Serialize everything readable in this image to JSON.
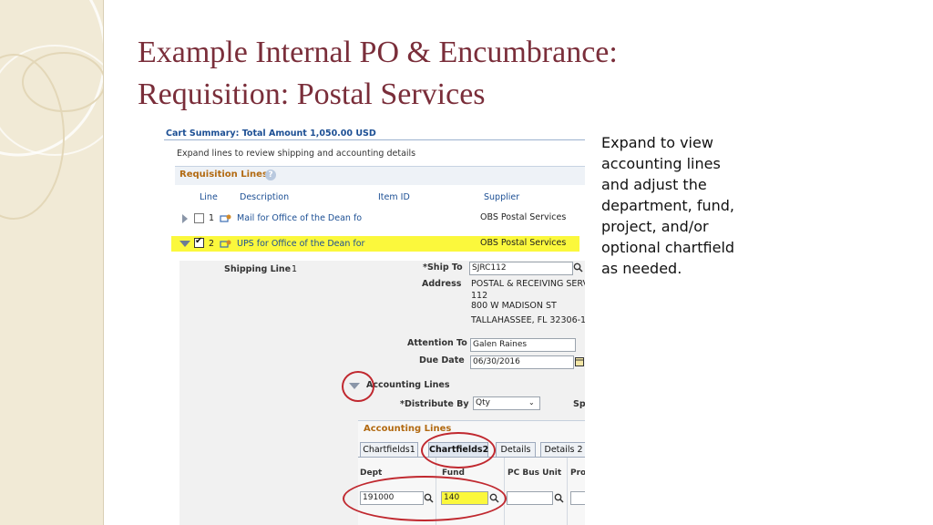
{
  "slide": {
    "title_line1": "Example Internal PO & Encumbrance:",
    "title_line2": "Requisition: Postal Services",
    "note": "Expand to view accounting lines and adjust the department, fund, project, and/or optional chartfield as needed."
  },
  "cart": {
    "summary": "Cart Summary: Total Amount 1,050.00 USD",
    "expand_hint": "Expand lines to review shipping and accounting details",
    "section_title": "Requisition Lines",
    "help": "?",
    "columns": [
      "Line",
      "Description",
      "Item ID",
      "Supplier"
    ],
    "lines": [
      {
        "num": "1",
        "description": "Mail for Office of the Dean fo",
        "supplier": "OBS Postal Services",
        "checked": false
      },
      {
        "num": "2",
        "description": "UPS for Office of the Dean for",
        "supplier": "OBS Postal Services",
        "checked": true
      }
    ]
  },
  "details": {
    "shipping_line_label": "Shipping Line",
    "shipping_line_value": "1",
    "ship_to_label": "*Ship To",
    "ship_to_value": "SJRC112",
    "address_label": "Address",
    "address_lines": [
      "POSTAL & RECEIVING SERV",
      "112",
      "800 W MADISON ST",
      "TALLAHASSEE, FL  32306-1"
    ],
    "attention_label": "Attention To",
    "attention_value": "Galen Raines",
    "due_label": "Due Date",
    "due_value": "06/30/2016",
    "acct_lines_label": "Accounting Lines",
    "distribute_label": "*Distribute By",
    "distribute_value": "Qty",
    "spe_cut": "Spe"
  },
  "accounting": {
    "title": "Accounting Lines",
    "tabs": [
      "Chartfields1",
      "Chartfields2",
      "Details",
      "Details 2"
    ],
    "active_tab": "Chartfields2",
    "columns": [
      "Dept",
      "Fund",
      "PC Bus Unit",
      "Proj"
    ],
    "dept_value": "191000",
    "fund_value": "140",
    "pc_bus_unit_value": "",
    "proj_value": ""
  },
  "colors": {
    "title": "#7a2e3a",
    "highlight": "#fbf83c",
    "annotation_ring": "#c0282f",
    "section_heading": "#b26a12",
    "link": "#1c4f94"
  }
}
